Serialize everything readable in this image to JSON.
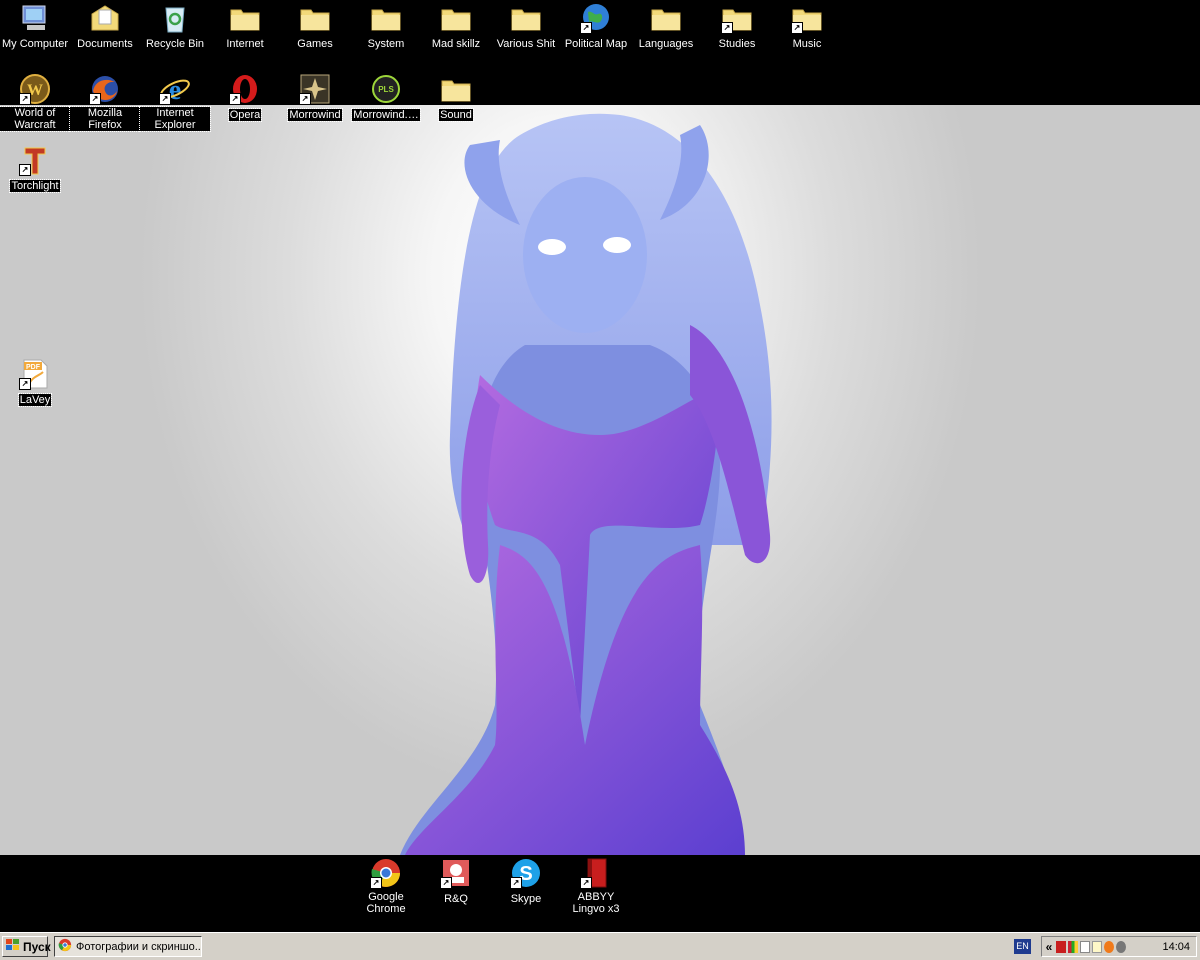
{
  "desktop": {
    "icons": [
      {
        "label": "My Computer",
        "icon": "computer-icon"
      },
      {
        "label": "Documents",
        "icon": "documents-icon"
      },
      {
        "label": "Recycle Bin",
        "icon": "recycle-bin-icon"
      },
      {
        "label": "Internet",
        "icon": "folder-icon"
      },
      {
        "label": "Games",
        "icon": "folder-icon"
      },
      {
        "label": "System",
        "icon": "folder-icon"
      },
      {
        "label": "Mad skillz",
        "icon": "folder-icon"
      },
      {
        "label": "Various Shit",
        "icon": "folder-icon"
      },
      {
        "label": "Political Map",
        "icon": "globe-icon"
      },
      {
        "label": "Languages",
        "icon": "folder-icon"
      },
      {
        "label": "Studies",
        "icon": "folder-icon"
      },
      {
        "label": "Music",
        "icon": "folder-icon"
      },
      {
        "label": "World of Warcraft",
        "icon": "wow-icon"
      },
      {
        "label": "Mozilla Firefox",
        "icon": "firefox-icon"
      },
      {
        "label": "Internet Explorer",
        "icon": "ie-icon"
      },
      {
        "label": "Opera",
        "icon": "opera-icon"
      },
      {
        "label": "Morrowind",
        "icon": "morrowind-icon"
      },
      {
        "label": "Morrowind.…",
        "icon": "pls-icon"
      },
      {
        "label": "Sound",
        "icon": "folder-icon"
      },
      {
        "label": "Torchlight",
        "icon": "torchlight-icon"
      },
      {
        "label": "LaVey",
        "icon": "pdf-icon"
      },
      {
        "label": "Google Chrome",
        "icon": "chrome-icon"
      },
      {
        "label": "R&Q",
        "icon": "rq-icon"
      },
      {
        "label": "Skype",
        "icon": "skype-icon"
      },
      {
        "label": "ABBYY Lingvo x3",
        "icon": "lingvo-icon"
      }
    ]
  },
  "taskbar": {
    "start_label": "Пуск",
    "task_label": "Фотографии и скриншо...",
    "lang": "EN",
    "tray_chevron": "«",
    "clock": "14:04"
  },
  "colors": {
    "folder": "#f2d97a",
    "wallpaper_light": "#f6f6f6",
    "wallpaper_dark": "#c9c9c9",
    "figure": "#7e8fe0"
  }
}
